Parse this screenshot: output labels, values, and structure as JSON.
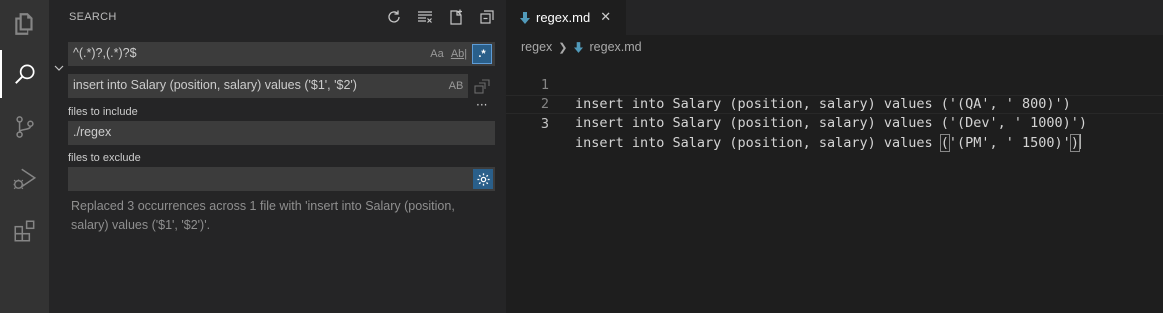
{
  "activity_bar": {
    "items": [
      {
        "name": "explorer",
        "icon": "files-icon"
      },
      {
        "name": "search",
        "icon": "search-icon",
        "active": true
      },
      {
        "name": "source-control",
        "icon": "source-control-icon"
      },
      {
        "name": "run-debug",
        "icon": "debug-icon"
      },
      {
        "name": "extensions",
        "icon": "extensions-icon"
      }
    ]
  },
  "sidebar": {
    "title": "SEARCH",
    "search_value": "^(.*)?,(.*)?$",
    "match_case_label": "Aa",
    "whole_word_label": "Ab|",
    "regex_label": ".*",
    "regex_active": true,
    "replace_value": "insert into Salary (position, salary) values ('$1', '$2')",
    "preserve_case_label": "AB",
    "more_label": "···",
    "include_label": "files to include",
    "include_value": "./regex",
    "exclude_label": "files to exclude",
    "exclude_value": "",
    "message": "Replaced 3 occurrences across 1 file with 'insert into Salary (position, salary) values ('$1', '$2')'."
  },
  "editor": {
    "tab_label": "regex.md",
    "close_label": "✕",
    "breadcrumb": [
      "regex",
      "regex.md"
    ],
    "lines": [
      {
        "number": "1",
        "text": "insert into Salary (position, salary) values ('(QA', ' 800)')"
      },
      {
        "number": "2",
        "text": "insert into Salary (position, salary) values ('(Dev', ' 1000)')"
      },
      {
        "number": "3",
        "pre": "insert into Salary (position, salary) values ",
        "open": "(",
        "mid": "'(PM', ' 1500)'",
        "close": ")"
      }
    ]
  },
  "colors": {
    "accent": "#2a5f8a",
    "markdown_icon": "#519aba"
  }
}
